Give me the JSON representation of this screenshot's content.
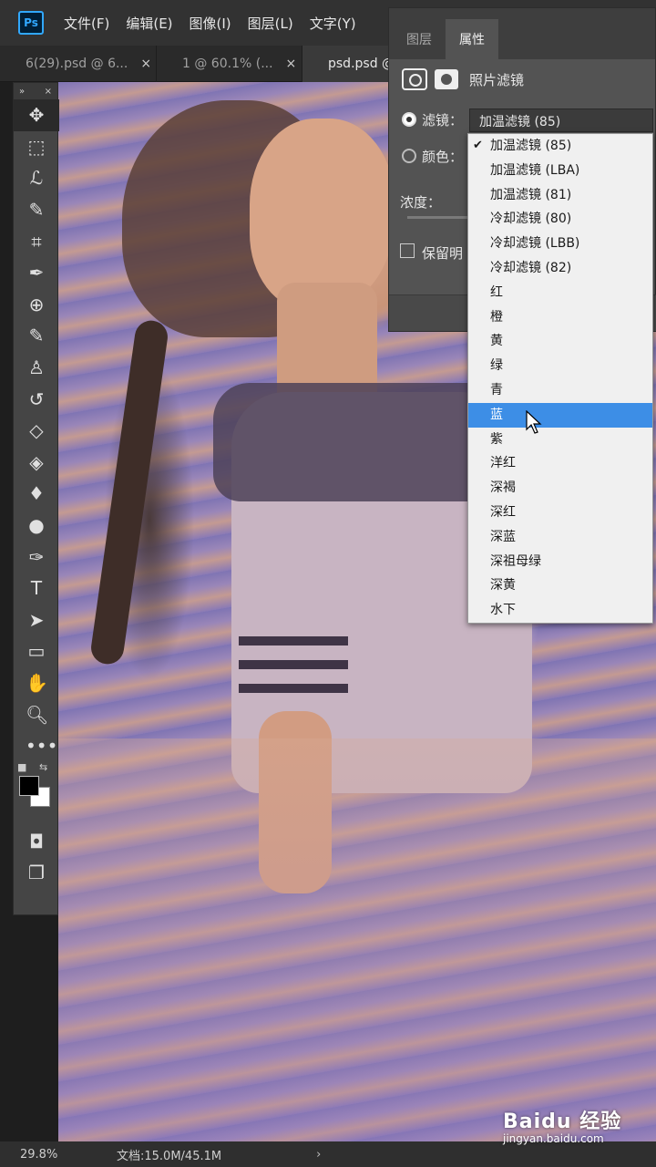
{
  "app": {
    "logo": "Ps"
  },
  "menu": [
    "文件(F)",
    "编辑(E)",
    "图像(I)",
    "图层(L)",
    "文字(Y)"
  ],
  "tabs": [
    {
      "label": "6(29).psd @ 6...",
      "close": "×"
    },
    {
      "label": "1 @ 60.1% (...",
      "close": "×"
    },
    {
      "label": "psd.psd @",
      "close": ""
    }
  ],
  "toolbar": {
    "header_left": "»",
    "header_right": "×",
    "tools": [
      {
        "name": "move-tool",
        "glyph": "✥",
        "selected": true
      },
      {
        "name": "marquee-tool",
        "glyph": "⬚"
      },
      {
        "name": "lasso-tool",
        "glyph": "ℒ"
      },
      {
        "name": "quick-select-tool",
        "glyph": "✎"
      },
      {
        "name": "crop-tool",
        "glyph": "⌗"
      },
      {
        "name": "eyedropper-tool",
        "glyph": "✒"
      },
      {
        "name": "healing-brush-tool",
        "glyph": "⊕"
      },
      {
        "name": "brush-tool",
        "glyph": "✎"
      },
      {
        "name": "clone-stamp-tool",
        "glyph": "♙"
      },
      {
        "name": "history-brush-tool",
        "glyph": "↺"
      },
      {
        "name": "eraser-tool",
        "glyph": "◇"
      },
      {
        "name": "paint-bucket-tool",
        "glyph": "◈"
      },
      {
        "name": "blur-tool",
        "glyph": "♦"
      },
      {
        "name": "dodge-tool",
        "glyph": "●"
      },
      {
        "name": "pen-tool",
        "glyph": "✑"
      },
      {
        "name": "type-tool",
        "glyph": "T"
      },
      {
        "name": "path-select-tool",
        "glyph": "➤"
      },
      {
        "name": "rectangle-tool",
        "glyph": "▭"
      },
      {
        "name": "hand-tool",
        "glyph": "✋"
      },
      {
        "name": "zoom-tool",
        "glyph": "🔍︎"
      },
      {
        "name": "more-tools",
        "glyph": "•••"
      }
    ],
    "mode_glyphs": [
      "◘",
      "❐"
    ]
  },
  "panel": {
    "tab_layers": "图层",
    "tab_properties": "属性",
    "title": "照片滤镜",
    "filter_label": "滤镜：",
    "filter_value": "加温滤镜 (85)",
    "color_label": "颜色：",
    "density_label": "浓度：",
    "preserve_label": "保留明"
  },
  "dropdown": {
    "checked_index": 0,
    "highlight_index": 11,
    "items": [
      "加温滤镜 (85)",
      "加温滤镜 (LBA)",
      "加温滤镜 (81)",
      "冷却滤镜 (80)",
      "冷却滤镜 (LBB)",
      "冷却滤镜 (82)",
      "红",
      "橙",
      "黄",
      "绿",
      "青",
      "蓝",
      "紫",
      "洋红",
      "深褐",
      "深红",
      "深蓝",
      "深祖母绿",
      "深黄",
      "水下"
    ]
  },
  "status": {
    "zoom": "29.8%",
    "doc": "文档:15.0M/45.1M",
    "arrow": "›"
  },
  "watermark": {
    "brand": "Baidu 经验",
    "url": "jingyan.baidu.com"
  },
  "colors": {
    "highlight": "#3d8ee6",
    "panel": "#535353",
    "ps_blue": "#31a8ff"
  }
}
